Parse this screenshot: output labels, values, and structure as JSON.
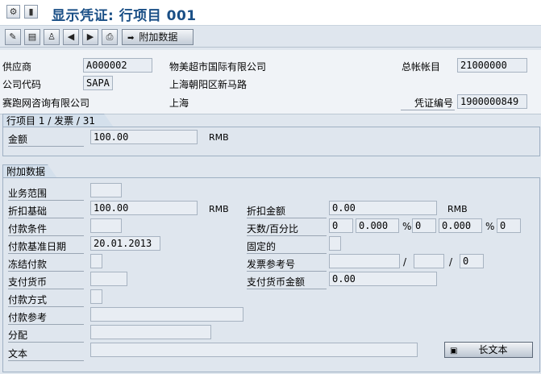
{
  "title": "显示凭证: 行项目 001",
  "toolbar": {
    "additional_data_label": "附加数据"
  },
  "header": {
    "vendor_label": "供应商",
    "vendor_value": "A000002",
    "vendor_name": "物美超市国际有限公司",
    "gl_label": "总帐帐目",
    "gl_value": "21000000",
    "company_label": "公司代码",
    "company_value": "SAPA",
    "vendor_street": "上海朝阳区新马路",
    "company_name": "赛跑网咨询有限公司",
    "vendor_city": "上海",
    "docnum_label": "凭证编号",
    "docnum_value": "1900000849"
  },
  "line_item": {
    "tab": "行项目 1 / 发票 / 31",
    "amount_label": "金额",
    "amount_value": "100.00",
    "currency": "RMB"
  },
  "additional": {
    "tab": "附加数据",
    "business_area_label": "业务范围",
    "business_area_value": "",
    "discount_base_label": "折扣基础",
    "discount_base_value": "100.00",
    "discount_base_currency": "RMB",
    "discount_amount_label": "折扣金额",
    "discount_amount_value": "0.00",
    "discount_amount_currency": "RMB",
    "payment_terms_label": "付款条件",
    "payment_terms_value": "",
    "days_pct_label": "天数/百分比",
    "days1": "0",
    "pct1": "0.000",
    "pct_sign": "%",
    "days2": "0",
    "pct2": "0.000",
    "days3": "0",
    "baseline_label": "付款基准日期",
    "baseline_value": "20.01.2013",
    "fixed_label": "固定的",
    "block_label": "冻结付款",
    "invoice_ref_label": "发票参考号",
    "invoice_ref_value": "",
    "invoice_ref_2": "",
    "invoice_ref_3": "0",
    "slash": "/",
    "pay_currency_label": "支付货币",
    "pay_currency_value": "",
    "pay_amount_label": "支付货币金额",
    "pay_amount_value": "0.00",
    "pay_method_label": "付款方式",
    "pay_ref_label": "付款参考",
    "pay_ref_value": "",
    "assignment_label": "分配",
    "assignment_value": "",
    "text_label": "文本",
    "text_value": "",
    "long_text_label": "长文本"
  }
}
